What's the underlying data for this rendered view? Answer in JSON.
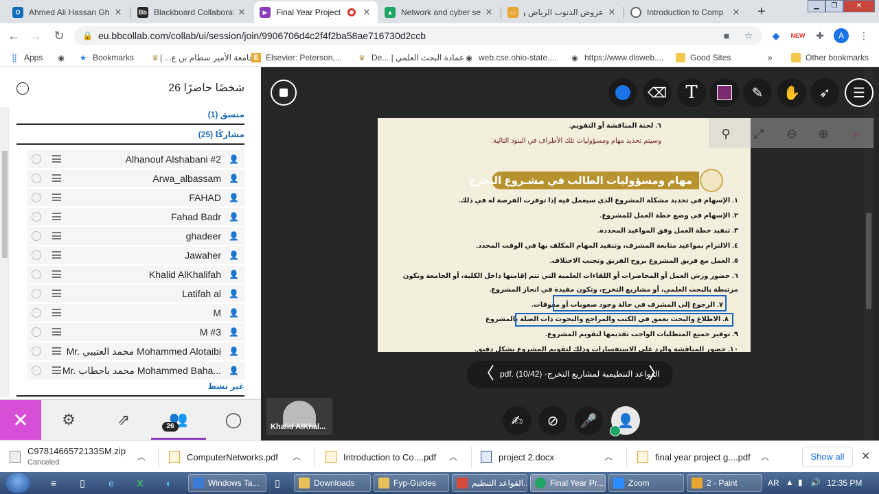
{
  "browser": {
    "tabs": [
      {
        "title": "Ahmed Ali Hassan Gh",
        "icon": "outlook-icon",
        "color": "#0f6cbd"
      },
      {
        "title": "Blackboard Collaborat",
        "icon": "blackboard-icon",
        "color": "#262626"
      },
      {
        "title": "Final Year Project",
        "icon": "video-icon",
        "color": "#8b3dbd"
      },
      {
        "title": "Network and cyber se",
        "icon": "drive-icon",
        "color": "#1fa463"
      },
      {
        "title": "عروض الذنوب الرياض والـ الدرق",
        "icon": "slides-icon",
        "color": "#e8a72f"
      },
      {
        "title": "Introduction to Comp",
        "icon": "globe-icon",
        "color": "#5f6368"
      }
    ],
    "url": "eu.bbcollab.com/collab/ui/session/join/9906706d4c2f4f2ba58ae716730d2ccb",
    "bookmarks": [
      "Apps",
      "Bookmarks",
      "جامعة الأمير سطام بن ع... |",
      "Elsevier: Peterson,...",
      "De... | عمادة البحث العلمي",
      "web.cse.ohio-state....",
      "https://www.dlsweb....",
      "Good Sites",
      "Other bookmarks"
    ]
  },
  "panel": {
    "title": "26 شخصًا حاضرًا",
    "moderator_header": "منسق (1)",
    "participant_header": "مشاركًا (25)",
    "participants": [
      "Alhanouf Alshabani #2",
      "Arwa_albassam",
      "FAHAD",
      "Fahad Badr",
      "ghadeer",
      "Jawaher",
      "Khalid AlKhalifah",
      "Latifah al",
      "M",
      "M #3",
      "Mr. محمد العتيبي Mohammed Alotaibi",
      "Mr. محمد باحطاب Mohammed Baha..."
    ],
    "inactive_header": "غير نشط",
    "participant_count": "26"
  },
  "document": {
    "lines_top": [
      "٦. لجنة المناقشة أو التقويم.",
      "وسيتم تحديد مهام ومسؤوليات تلك الأطراف في البنود التالية:"
    ],
    "section_title": "مهام ومسؤوليات الطالب في مشـروع التخرج",
    "items": [
      "١. الإسهام في تحديد مشكلة المشروع الذي سيعمل فيه إذا توفرت الفرصة له في ذلك.",
      "٢. الإسهام في وضع خطة العمل للمشروع.",
      "٣. تنفيذ خطة العمل وفق المواعيد المحددة.",
      "٤. الالتزام بمواعيد متابعة المشرف، وتنفيذ المهام المكلف بها في الوقت المحدد.",
      "٥. العمل مع فريق المشروع بروح الفريق وتجنب الاختلاف.",
      "٦. حضور ورش العمل أو المحاضرات أو اللقاءات العلمية التي تتم إقامتها داخل الكلية، أو الجامعة وتكون",
      "مرتبطة بالبحث العلمي، أو مشاريع التخرج، وتكون مفيدة في انجاز المشروع.",
      "٧. الرجوع إلى المشرف في حالة وجود صعوبات أو معوقات.",
      "٨. الاطلاع والبحث بعمق في الكتب والمراجع والبحوث ذات الصلة بالمشروع",
      "٩. توفير جميع المتطلبات الواجب تقديمها لتقويم المشروع.",
      "١٠. حضور المناقشة والرد على الاستفسارات وذلك لتقويم المشروع بشكل دقيق."
    ],
    "file_name": "القواعد التنظيمية لمشاريع التخرج- pdf.",
    "page": "(10/42)"
  },
  "video": {
    "name": "Khalid AlKhal..."
  },
  "downloads": [
    {
      "name": "C9781466572133SM.zip",
      "status": "Canceled"
    },
    {
      "name": "ComputerNetworks.pdf"
    },
    {
      "name": "Introduction to Co....pdf"
    },
    {
      "name": "project 2.docx"
    },
    {
      "name": "final year project g....pdf"
    }
  ],
  "downloads_show_all": "Show all",
  "taskbar": {
    "items": [
      {
        "title": "Windows Ta...",
        "color": "#3a7bd5"
      },
      {
        "title": "Downloads",
        "color": "#e8c15a"
      },
      {
        "title": "Fyp-Guides",
        "color": "#e8c15a"
      },
      {
        "title": "القواعد التنظيم...",
        "color": "#d64a3b"
      },
      {
        "title": "Final Year Pr...",
        "color": "#1fa463"
      },
      {
        "title": "Zoom",
        "color": "#2d8cff"
      },
      {
        "title": "2 - Paint",
        "color": "#e8a72f"
      }
    ],
    "lang": "AR",
    "time": "12:35 PM"
  }
}
